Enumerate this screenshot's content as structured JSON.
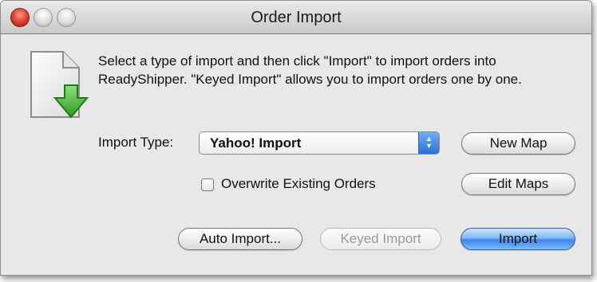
{
  "window": {
    "title": "Order Import",
    "icon": "document-download-icon"
  },
  "description": "Select a type of import and then click \"Import\" to import orders into ReadyShipper. \"Keyed Import\" allows you to import orders one by one.",
  "import_type": {
    "label": "Import Type:",
    "selected": "Yahoo! Import"
  },
  "buttons": {
    "new_map": "New Map",
    "edit_maps": "Edit Maps",
    "auto_import": "Auto Import...",
    "keyed_import": "Keyed Import",
    "import": "Import"
  },
  "overwrite": {
    "label": "Overwrite Existing Orders",
    "checked": false
  },
  "colors": {
    "close_button": "#e0493a",
    "default_button": "#3d86ea",
    "download_arrow": "#3caa2b"
  }
}
